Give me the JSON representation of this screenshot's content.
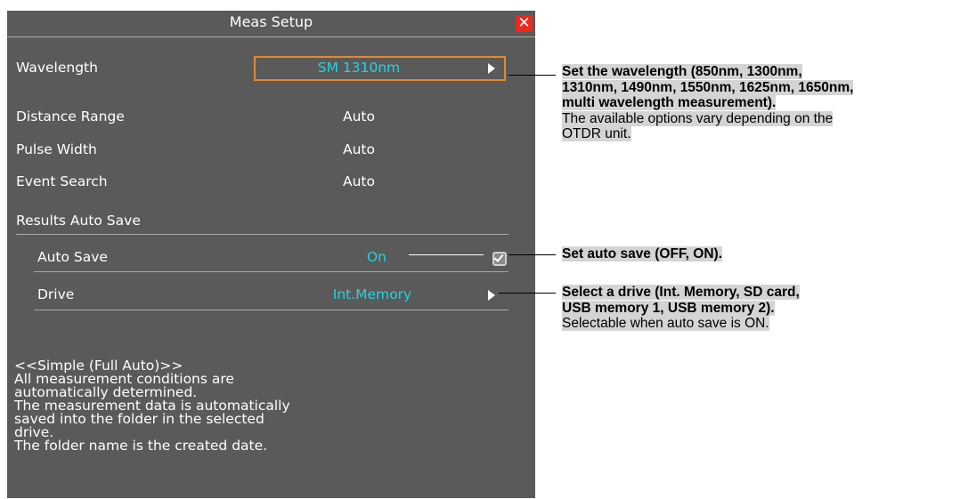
{
  "dialog": {
    "title": "Meas Setup",
    "close_icon": "close-icon",
    "rows": {
      "wavelength": {
        "label": "Wavelength",
        "value": "SM 1310nm"
      },
      "distance_range": {
        "label": "Distance Range",
        "value": "Auto"
      },
      "pulse_width": {
        "label": "Pulse Width",
        "value": "Auto"
      },
      "event_search": {
        "label": "Event Search",
        "value": "Auto"
      },
      "results_auto_save": {
        "label": "Results Auto Save"
      },
      "auto_save": {
        "label": "Auto Save",
        "value": "On",
        "checked": true
      },
      "drive": {
        "label": "Drive",
        "value": "Int.Memory"
      }
    },
    "description": [
      "<<Simple (Full Auto)>>",
      "All measurement conditions are",
      "automatically determined.",
      "The measurement data is automatically",
      "saved into the folder in the selected",
      "drive.",
      "The folder name is the created date."
    ]
  },
  "annotations": {
    "wavelength": {
      "bold_lines": [
        "Set the wavelength (850nm, 1300nm,",
        "1310nm, 1490nm, 1550nm, 1625nm, 1650nm,",
        "multi wavelength measurement)."
      ],
      "normal_lines": [
        "The available options vary depending on the",
        "OTDR unit."
      ]
    },
    "auto_save": {
      "bold_lines": [
        "Set auto save (OFF, ON)."
      ]
    },
    "drive": {
      "bold_lines": [
        "Select a drive (Int. Memory, SD card,",
        "USB memory 1, USB memory 2)."
      ],
      "normal_lines": [
        "Selectable when auto save is ON."
      ]
    }
  },
  "colors": {
    "panel": "#5a5a5a",
    "highlight_border": "#e08a2c",
    "value_cyan": "#22d3e2",
    "close_red": "#e8291c",
    "annotation_bg": "#d4d4d4"
  }
}
